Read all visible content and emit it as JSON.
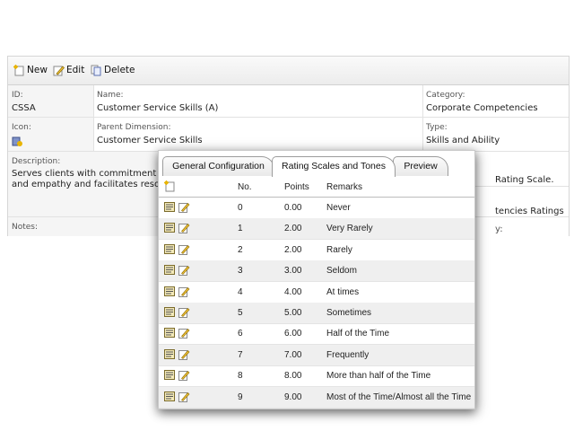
{
  "toolbar": {
    "new_label": "New",
    "edit_label": "Edit",
    "delete_label": "Delete"
  },
  "fields": {
    "id": {
      "label": "ID:",
      "value": "CSSA"
    },
    "name": {
      "label": "Name:",
      "value": "Customer Service Skills (A)"
    },
    "category": {
      "label": "Category:",
      "value": "Corporate Competencies"
    },
    "icon": {
      "label": "Icon:"
    },
    "parent_dimension": {
      "label": "Parent Dimension:",
      "value": "Customer Service Skills"
    },
    "type": {
      "label": "Type:",
      "value": "Skills and Ability"
    },
    "description": {
      "label": "Description:",
      "line1": "Serves clients with commitment a",
      "line2": "and empathy and facilitates resol"
    },
    "rating_scale": {
      "value": "Rating Scale."
    },
    "ratings": {
      "value": "tencies Ratings"
    },
    "notes": {
      "label": "Notes:"
    },
    "notes_right": {
      "value": "y:"
    }
  },
  "dialog": {
    "tabs": [
      "General Configuration",
      "Rating Scales and Tones",
      "Preview"
    ],
    "active_tab": "Rating Scales and Tones",
    "columns": [
      "No.",
      "Points",
      "Remarks"
    ],
    "rows": [
      {
        "no": "0",
        "points": "0.00",
        "remarks": "Never"
      },
      {
        "no": "1",
        "points": "2.00",
        "remarks": "Very Rarely"
      },
      {
        "no": "2",
        "points": "2.00",
        "remarks": "Rarely"
      },
      {
        "no": "3",
        "points": "3.00",
        "remarks": "Seldom"
      },
      {
        "no": "4",
        "points": "4.00",
        "remarks": "At times"
      },
      {
        "no": "5",
        "points": "5.00",
        "remarks": "Sometimes"
      },
      {
        "no": "6",
        "points": "6.00",
        "remarks": "Half of the Time"
      },
      {
        "no": "7",
        "points": "7.00",
        "remarks": "Frequently"
      },
      {
        "no": "8",
        "points": "8.00",
        "remarks": "More than half of the Time"
      },
      {
        "no": "9",
        "points": "9.00",
        "remarks": "Most of the Time/Almost all the Time"
      }
    ]
  },
  "icons": {
    "new": "new-document-icon",
    "edit": "edit-pencil-icon",
    "delete": "delete-document-icon",
    "row_view": "view-record-icon",
    "row_edit": "edit-record-icon",
    "dimension": "dimension-icon"
  }
}
